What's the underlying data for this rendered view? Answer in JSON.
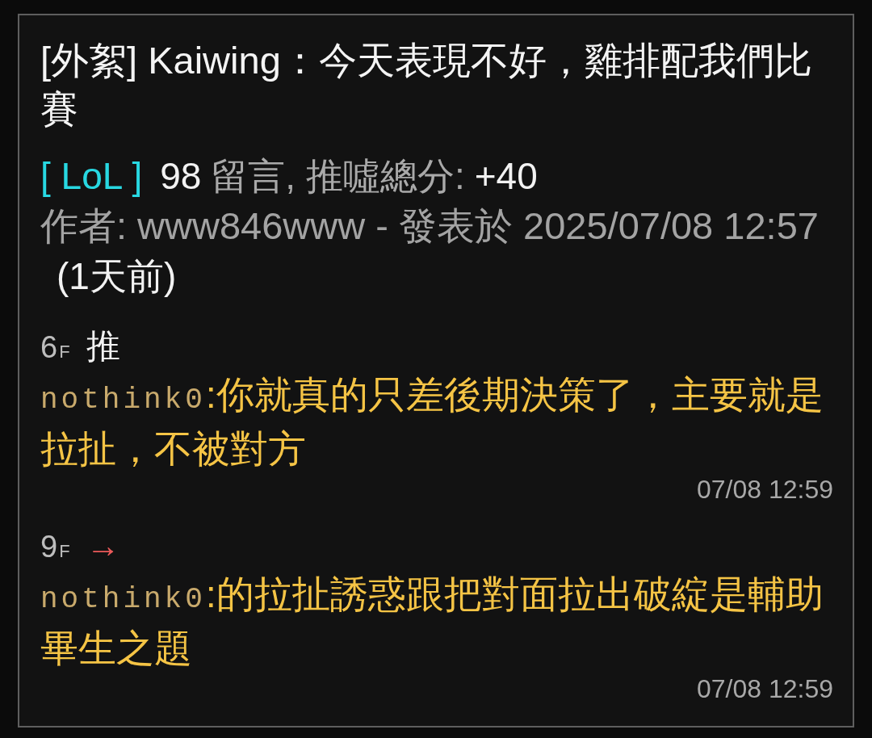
{
  "post": {
    "title": "[外絮] Kaiwing：今天表現不好，雞排配我們比賽",
    "board": "[ LoL ]",
    "comment_count": "98",
    "comment_label": "留言, 推噓總分:",
    "score": "+40",
    "author_line": "作者: www846www - 發表於 2025/07/08 12:57",
    "relative_time": "(1天前)"
  },
  "comments": [
    {
      "floor": "6",
      "floor_suffix": "F",
      "kind": "push",
      "tag": "推",
      "user": "nothink0",
      "text": ":你就真的只差後期決策了，主要就是拉扯，不被對方",
      "time": "07/08 12:59"
    },
    {
      "floor": "9",
      "floor_suffix": "F",
      "kind": "arrow",
      "tag": "→",
      "user": "nothink0",
      "text": ":的拉扯誘惑跟把對面拉出破綻是輔助畢生之題",
      "time": "07/08 12:59"
    }
  ]
}
